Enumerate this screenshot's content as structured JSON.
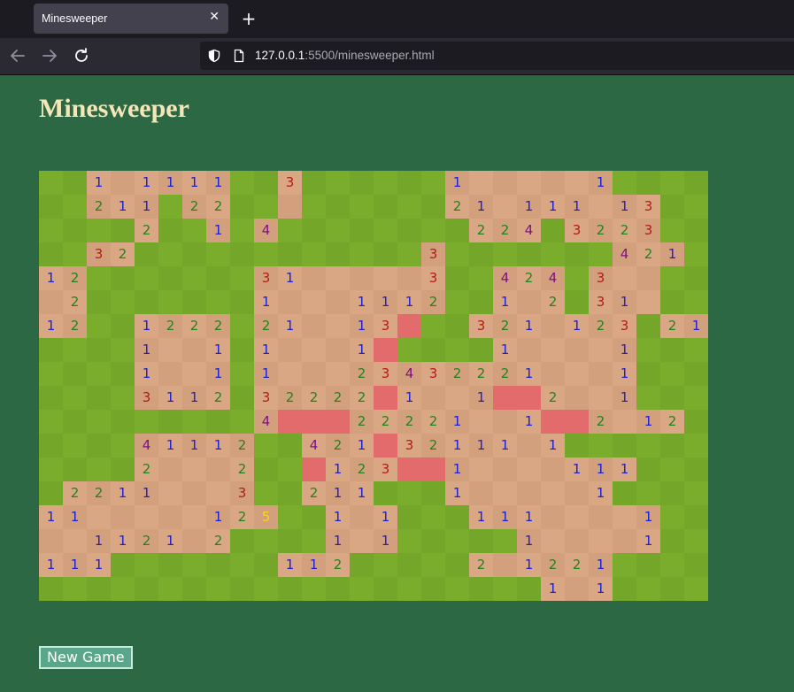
{
  "browser": {
    "tab_title": "Minesweeper",
    "tab_close_icon": "close-icon",
    "new_tab_icon": "plus-icon",
    "url_host": "127.0.0.1",
    "url_rest": ":5500/minesweeper.html",
    "nav_icons": [
      "back-arrow-icon",
      "forward-arrow-icon",
      "reload-icon"
    ],
    "url_icons": [
      "shield-icon",
      "page-icon"
    ]
  },
  "game": {
    "title": "Minesweeper",
    "new_game_label": "New Game",
    "colors": {
      "background": "#2d6845",
      "grass_light": "#7aad2c",
      "grass_dark": "#74a62a",
      "revealed_light": "#daa784",
      "revealed_dark": "#d3a07d",
      "mine": "#e36b6b",
      "title": "#f5e6b8"
    },
    "number_colors": {
      "1": "#1c20d4",
      "2": "#23821c",
      "3": "#b01d12",
      "4": "#7d1180",
      "5": "#f5d321"
    },
    "legend": "# = unrevealed grass, . = revealed empty, M = red mine cell, digits = revealed count",
    "grid": [
      "##1.1111##3######1.....1##",
      "##211#22##.######21.111.13",
      "####2##1#4########224#3223",
      "##32############3#######421",
      "12#######31.....3##424#3..",
      ".2#######1...1112##1.2#31.",
      "12##1222#21..13M##321.123#21",
      "####1..1#1...1M####1....1##",
      "####1..1#1...23432221...1##",
      "####3112#32222M1..1MM2..1##",
      "#########4MMM22221..1MM2.12##",
      "####41112##421M32111.1####",
      "####2...2##M123MM1....111#",
      "#2211...3##211###1.....1##",
      "11.....125##1.1###111....1",
      "..1121 2####1.1#####1....1",
      "111#######112#####2.1221##",
      "#####################1.1###"
    ]
  }
}
